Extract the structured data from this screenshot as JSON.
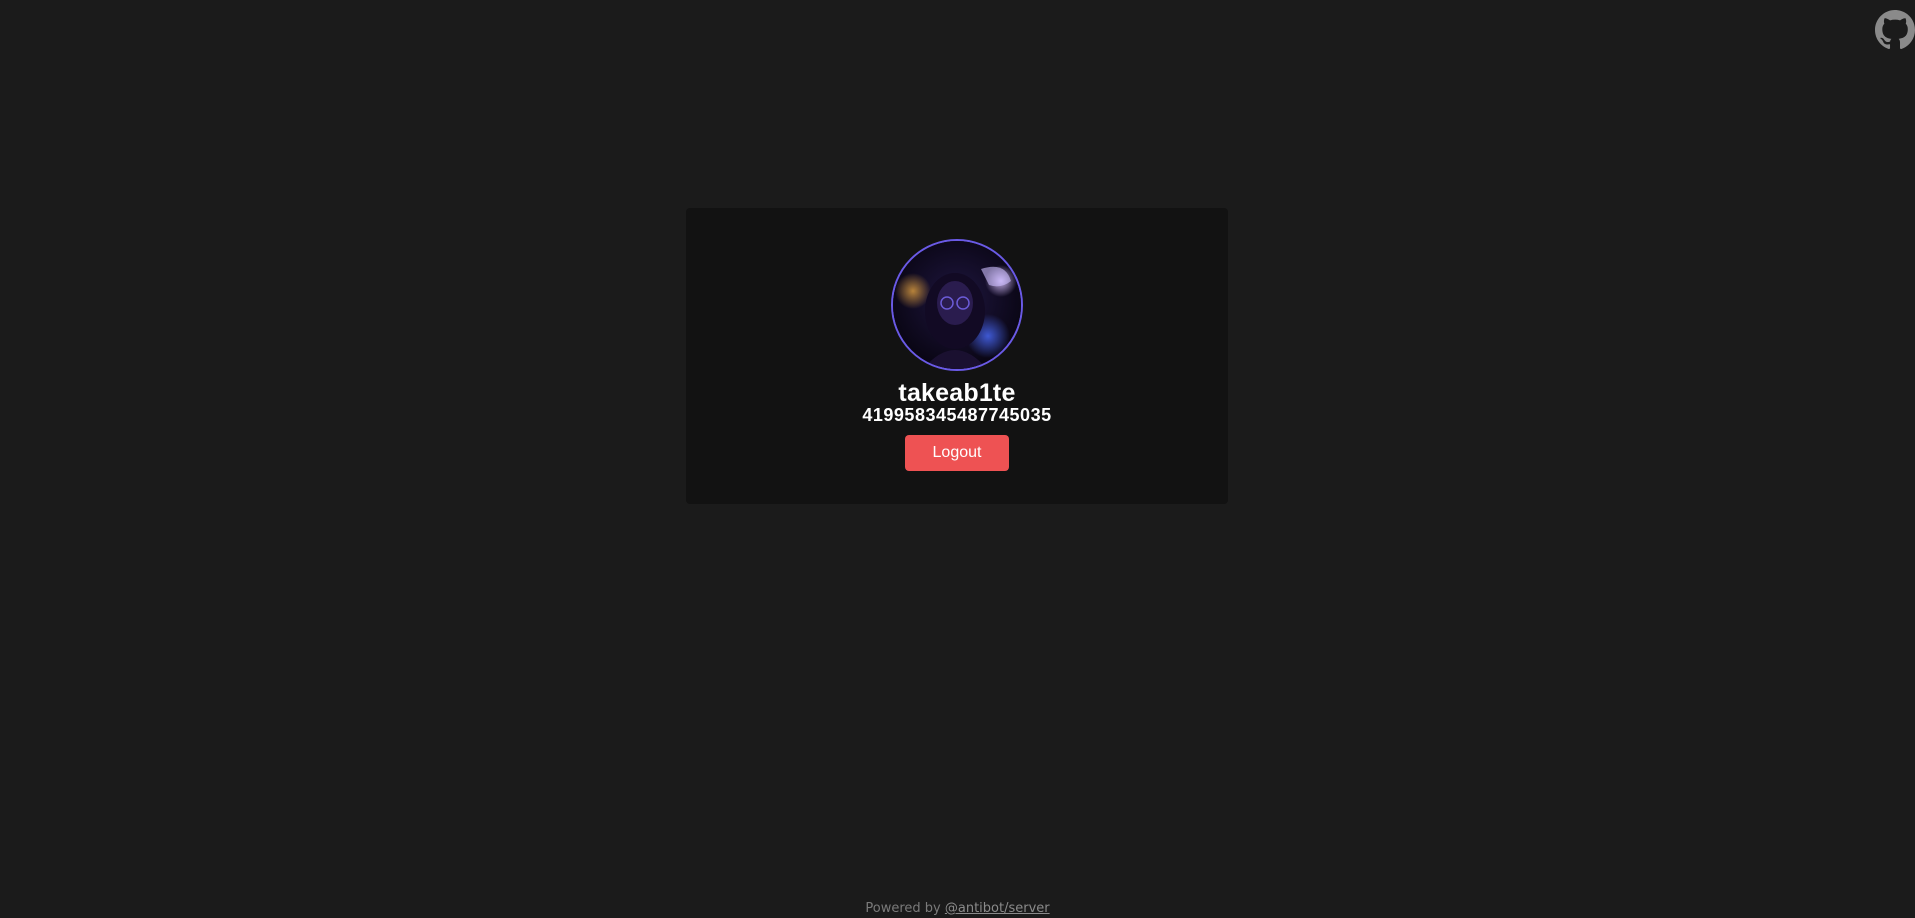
{
  "header": {
    "github_icon": "github-icon"
  },
  "profile": {
    "avatar_icon": "avatar-image",
    "username": "takeab1te",
    "user_id": "419958345487745035",
    "logout_label": "Logout"
  },
  "footer": {
    "prefix": "Powered by ",
    "link_text": "@antibot/server"
  },
  "colors": {
    "background": "#1b1b1b",
    "card": "#121212",
    "avatar_border": "#6a5ae6",
    "logout_button": "#ee5253",
    "text": "#ffffff",
    "muted": "#7a7a7a"
  }
}
